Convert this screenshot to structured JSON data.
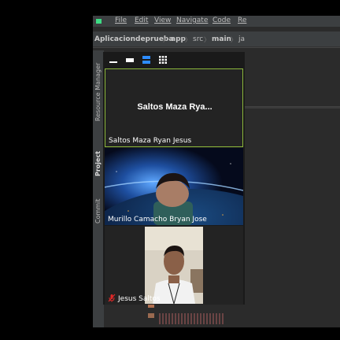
{
  "ide": {
    "menu": [
      "File",
      "Edit",
      "View",
      "Navigate",
      "Code",
      "Re"
    ],
    "breadcrumb": {
      "project": "Aplicaciondeprueba",
      "module": "app",
      "src": "src",
      "main": "main",
      "java": "ja"
    },
    "side_tabs": [
      "Resource Manager",
      "Project",
      "Commit"
    ]
  },
  "meeting": {
    "participants": [
      {
        "name": "Saltos Maza Ryan Jesus",
        "display": "Saltos  Maza  Rya...",
        "video": "off",
        "active_speaker": true
      },
      {
        "name": "Murillo Camacho Bryan Jose",
        "video": "on"
      },
      {
        "name": "Jesus Saltos",
        "video": "on",
        "muted": true
      }
    ],
    "layout_icons": [
      "minimize-icon",
      "thumbnail-icon",
      "speaker-view-icon",
      "gallery-view-icon"
    ],
    "colors": {
      "active_border": "#8cb83c",
      "selected_layout": "#2d8cff",
      "muted": "#e02828"
    }
  }
}
